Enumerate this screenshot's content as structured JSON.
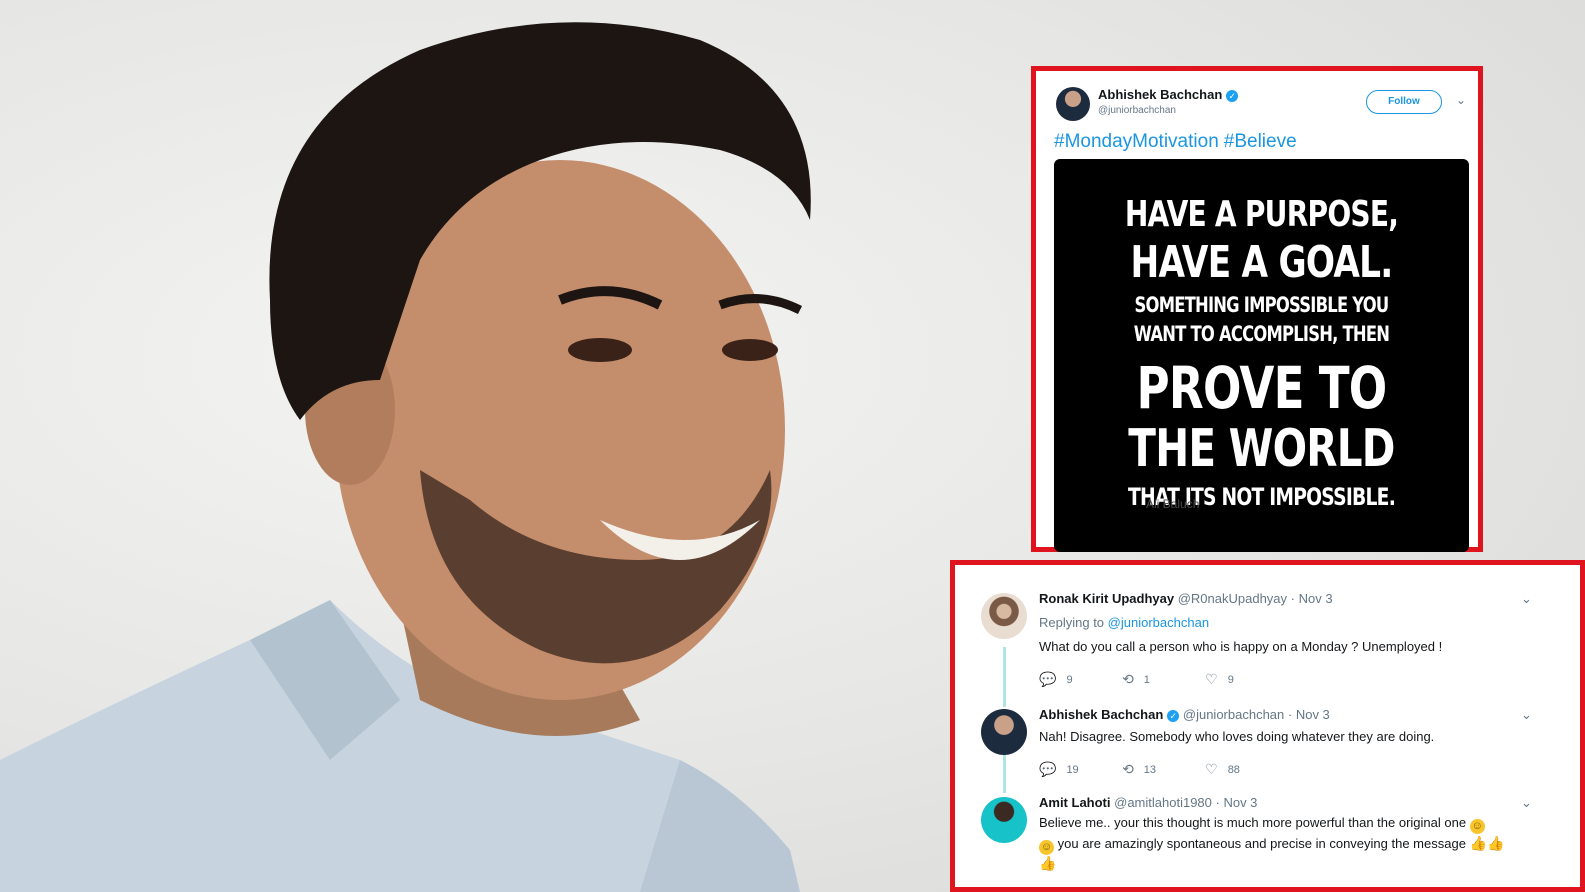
{
  "tweet": {
    "author_name": "Abhishek Bachchan",
    "author_handle": "@juniorbachchan",
    "follow_label": "Follow",
    "hashtags": [
      "#MondayMotivation",
      "#Believe"
    ],
    "image": {
      "lines": [
        "HAVE A PURPOSE,",
        "HAVE A GOAL.",
        "SOMETHING IMPOSSIBLE YOU",
        "WANT TO ACCOMPLISH, THEN",
        "PROVE TO",
        "THE WORLD",
        "THAT ITS NOT IMPOSSIBLE."
      ],
      "author": "Ali Baluch"
    }
  },
  "replies": [
    {
      "name": "Ronak Kirit Upadhyay",
      "handle": "@R0nakUpadhyay",
      "date": "· Nov 3",
      "replying_to_label": "Replying to",
      "replying_to_handle": "@juniorbachchan",
      "text": "What do you call a person who is happy on a Monday ? Unemployed !",
      "counts": {
        "replies": "9",
        "retweets": "1",
        "likes": "9"
      }
    },
    {
      "name": "Abhishek Bachchan",
      "handle": "@juniorbachchan",
      "date": "· Nov 3",
      "text": "Nah! Disagree. Somebody who loves doing whatever they are doing.",
      "counts": {
        "replies": "19",
        "retweets": "13",
        "likes": "88"
      }
    },
    {
      "name": "Amit Lahoti",
      "handle": "@amitlahoti1980",
      "date": "· Nov 3",
      "text_line1": "Believe me.. your this thought is much more powerful than the original one",
      "text_line2": "you are amazingly spontaneous and precise in conveying the message"
    }
  ],
  "colors": {
    "accent": "#1b95e0",
    "highlight_border": "#e0141e",
    "thread_line": "#aee4e6"
  },
  "icons": {
    "reply": "speech-bubble",
    "retweet": "retweet-arrows",
    "like": "heart",
    "more": "chevron-down",
    "verified": "verified-check"
  }
}
